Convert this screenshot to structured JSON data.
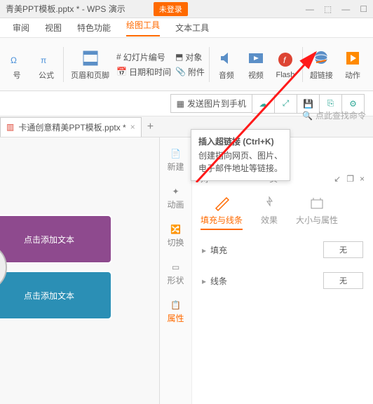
{
  "title": {
    "filename": "青美PPT模板.pptx * - WPS 演示",
    "unlogin": "未登录"
  },
  "menu": {
    "review": "审阅",
    "view": "视图",
    "special": "特色功能",
    "drawtools": "绘图工具",
    "texttools": "文本工具"
  },
  "ribbon": {
    "symbol": "号",
    "formula": "公式",
    "headerfooter": "页眉和页脚",
    "slideNum": "幻灯片编号",
    "object": "对象",
    "datetime": "日期和时间",
    "attach": "附件",
    "audio": "音频",
    "video": "视频",
    "flash": "Flash",
    "hyperlink": "超链接",
    "action": "动作"
  },
  "sendbar": {
    "send": "发送图片到手机"
  },
  "doctab": {
    "name": "卡通创意精美PPT模板.pptx *"
  },
  "slide": {
    "ph1": "点击添加文本",
    "ph2": "点击添加文本"
  },
  "midtool": {
    "new": "新建",
    "anim": "动画",
    "trans": "切换",
    "shape": "形状",
    "attr": "属性"
  },
  "tooltip": {
    "title": "插入超链接 (Ctrl+K)",
    "l1": "创建指向网页、图片、",
    "l2": "电子邮件地址等链接。"
  },
  "search": {
    "hint": "点此查找命令"
  },
  "objpanel": {
    "header": "对",
    "page": "页",
    "tab_fill": "填充与线条",
    "tab_effect": "效果",
    "tab_size": "大小与属性",
    "fill": "填充",
    "line": "线条",
    "none": "无"
  }
}
